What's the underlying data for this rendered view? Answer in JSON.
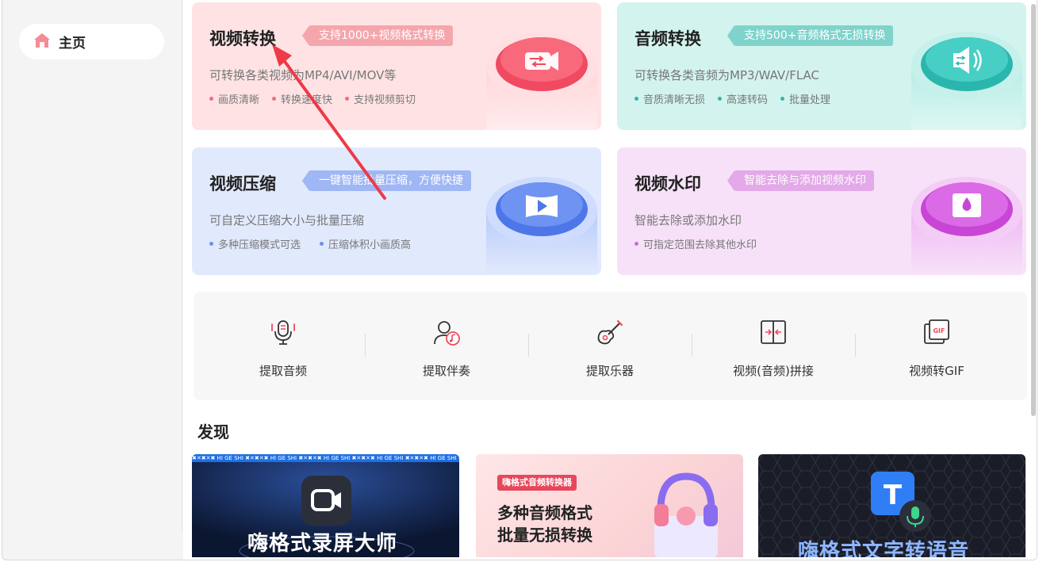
{
  "sidebar": {
    "home_label": "主页"
  },
  "cards": [
    {
      "title": "视频转换",
      "tag": "支持1000+视频格式转换",
      "desc": "可转换各类视频为MP4/AVI/MOV等",
      "features": [
        "画质清晰",
        "转换速度快",
        "支持视频剪切"
      ],
      "accent": "#f06b7d"
    },
    {
      "title": "音频转换",
      "tag": "支持500+音频格式无损转换",
      "desc": "可转换各类音频为MP3/WAV/FLAC",
      "features": [
        "音质清晰无损",
        "高速转码",
        "批量处理"
      ],
      "accent": "#4dbfb8"
    },
    {
      "title": "视频压缩",
      "tag": "一键智能批量压缩，方便快捷",
      "desc": "可自定义压缩大小与批量压缩",
      "features": [
        "多种压缩模式可选",
        "压缩体积小画质高"
      ],
      "accent": "#7f9ef0"
    },
    {
      "title": "视频水印",
      "tag": "智能去除与添加视频水印",
      "desc": "智能去除或添加水印",
      "features": [
        "可指定范围去除其他水印"
      ],
      "accent": "#d78ee0"
    }
  ],
  "tools": [
    {
      "label": "提取音频",
      "icon": "microphone-icon"
    },
    {
      "label": "提取伴奏",
      "icon": "singer-icon"
    },
    {
      "label": "提取乐器",
      "icon": "guitar-icon"
    },
    {
      "label": "视频(音频)拼接",
      "icon": "merge-icon"
    },
    {
      "label": "视频转GIF",
      "icon": "gif-icon"
    }
  ],
  "discover": {
    "title": "发现",
    "banners": [
      {
        "ticker": "HI GE SHI",
        "headline": "嗨格式录屏大师"
      },
      {
        "badge": "嗨格式音频转换器",
        "line1": "多种音频格式",
        "line2": "批量无损转换"
      },
      {
        "headline": "嗨格式文字转语音"
      }
    ]
  },
  "colors": {
    "primary": "#f0495f",
    "red_card_bg": "#ffe5e6",
    "teal_card_bg": "#d6f4ef",
    "blue_card_bg": "#e1eafe",
    "purple_card_bg": "#f8e3f9"
  }
}
